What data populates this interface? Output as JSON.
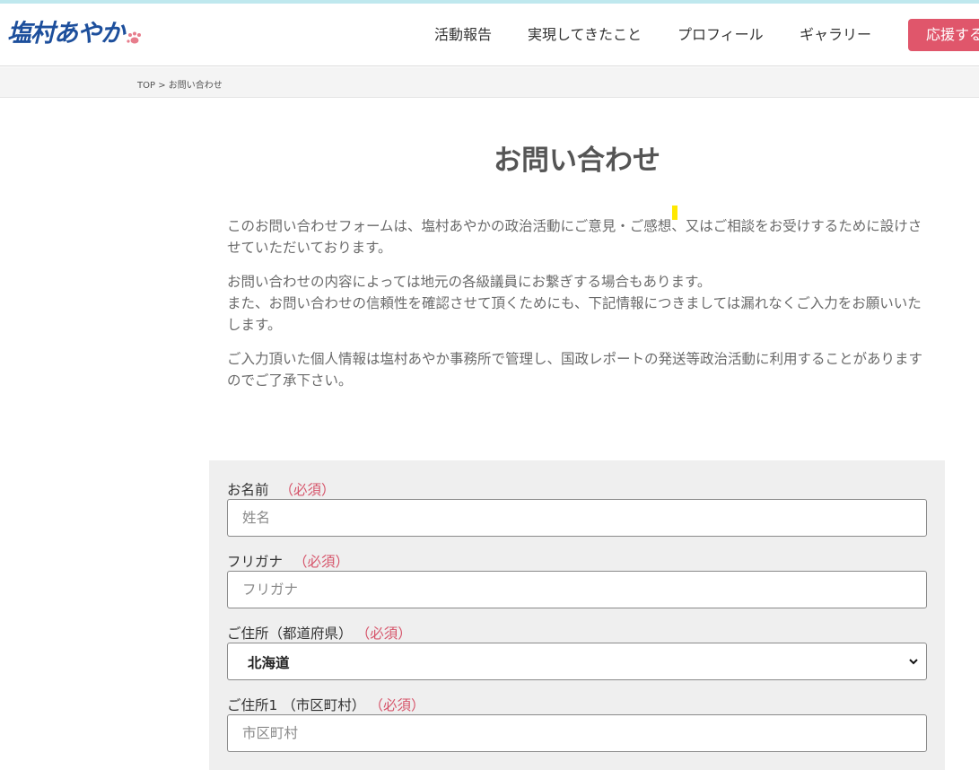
{
  "header": {
    "logo_text": "塩村あやか",
    "nav": [
      "活動報告",
      "実現してきたこと",
      "プロフィール",
      "ギャラリー"
    ],
    "support_label": "応援する",
    "colors": {
      "brand_blue": "#1d4f9c",
      "accent_pink": "#e0566b",
      "required": "#d6546a"
    }
  },
  "breadcrumb": "TOP > お問い合わせ",
  "page_title": "お問い合わせ",
  "intro": [
    "このお問い合わせフォームは、塩村あやかの政治活動にご意見・ご感想、又はご相談をお受けするために設けさせていただいております。",
    "お問い合わせの内容によっては地元の各級議員にお繋ぎする場合もあります。\nまた、お問い合わせの信頼性を確認させて頂くためにも、下記情報につきましては漏れなくご入力をお願いいたします。",
    "ご入力頂いた個人情報は塩村あやか事務所で管理し、国政レポートの発送等政治活動に利用することがありますのでご了承下さい。"
  ],
  "form": {
    "required_label": "（必須）",
    "name": {
      "label": "お名前",
      "placeholder": "姓名",
      "value": ""
    },
    "kana": {
      "label": "フリガナ",
      "placeholder": "フリガナ",
      "value": ""
    },
    "prefecture": {
      "label": "ご住所（都道府県）",
      "selected": "北海道"
    },
    "city": {
      "label": "ご住所1 （市区町村）",
      "placeholder": "市区町村",
      "value": ""
    }
  }
}
